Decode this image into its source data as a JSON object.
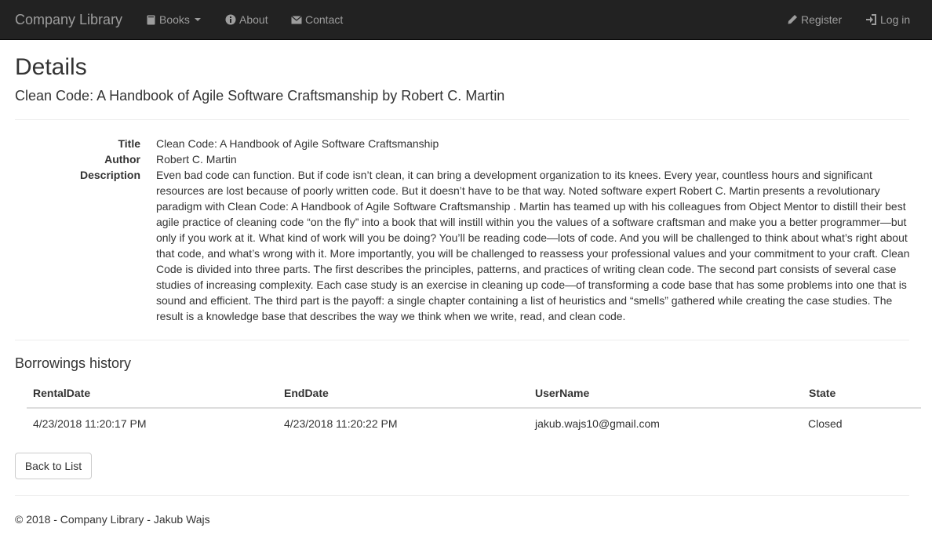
{
  "navbar": {
    "brand": "Company Library",
    "items": [
      {
        "label": "Books",
        "icon": "book-icon"
      },
      {
        "label": "About",
        "icon": "info-sign-icon"
      },
      {
        "label": "Contact",
        "icon": "envelope-icon"
      }
    ],
    "right_items": [
      {
        "label": "Register",
        "icon": "pencil-icon"
      },
      {
        "label": "Log in",
        "icon": "log-in-icon"
      }
    ]
  },
  "page": {
    "title": "Details",
    "subtitle": "Clean Code: A Handbook of Agile Software Craftsmanship by Robert C. Martin"
  },
  "details": {
    "title_label": "Title",
    "title_value": "Clean Code: A Handbook of Agile Software Craftsmanship",
    "author_label": "Author",
    "author_value": "Robert C. Martin",
    "description_label": "Description",
    "description_value": "Even bad code can function. But if code isn’t clean, it can bring a development organization to its knees. Every year, countless hours and significant resources are lost because of poorly written code. But it doesn’t have to be that way.  Noted software expert Robert C. Martin presents a revolutionary paradigm with Clean Code: A Handbook of Agile Software Craftsmanship . Martin has teamed up with his colleagues from Object Mentor to distill their best agile practice of cleaning code “on the fly” into a book that will instill within you the values of a software craftsman and make you a better programmer—but only if you work at it.  What kind of work will you be doing? You’ll be reading code—lots of code. And you will be challenged to think about what’s right about that code, and what’s wrong with it. More importantly, you will be challenged to reassess your professional values and your commitment to your craft.  Clean Code is divided into three parts. The first describes the principles, patterns, and practices of writing clean code. The second part consists of several case studies of increasing complexity. Each case study is an exercise in cleaning up code—of transforming a code base that has some problems into one that is sound and efficient. The third part is the payoff: a single chapter containing a list of heuristics and “smells” gathered while creating the case studies. The result is a knowledge base that describes the way we think when we write, read, and clean code."
  },
  "borrowings": {
    "heading": "Borrowings history",
    "columns": [
      "RentalDate",
      "EndDate",
      "UserName",
      "State"
    ],
    "rows": [
      [
        "4/23/2018 11:20:17 PM",
        "4/23/2018 11:20:22 PM",
        "jakub.wajs10@gmail.com",
        "Closed"
      ]
    ]
  },
  "back_button": "Back to List",
  "footer": "© 2018 - Company Library - Jakub Wajs",
  "colors": {
    "navbar_bg": "#222222",
    "navbar_text": "#9d9d9d",
    "text": "#333333",
    "divider": "#eeeeee"
  }
}
